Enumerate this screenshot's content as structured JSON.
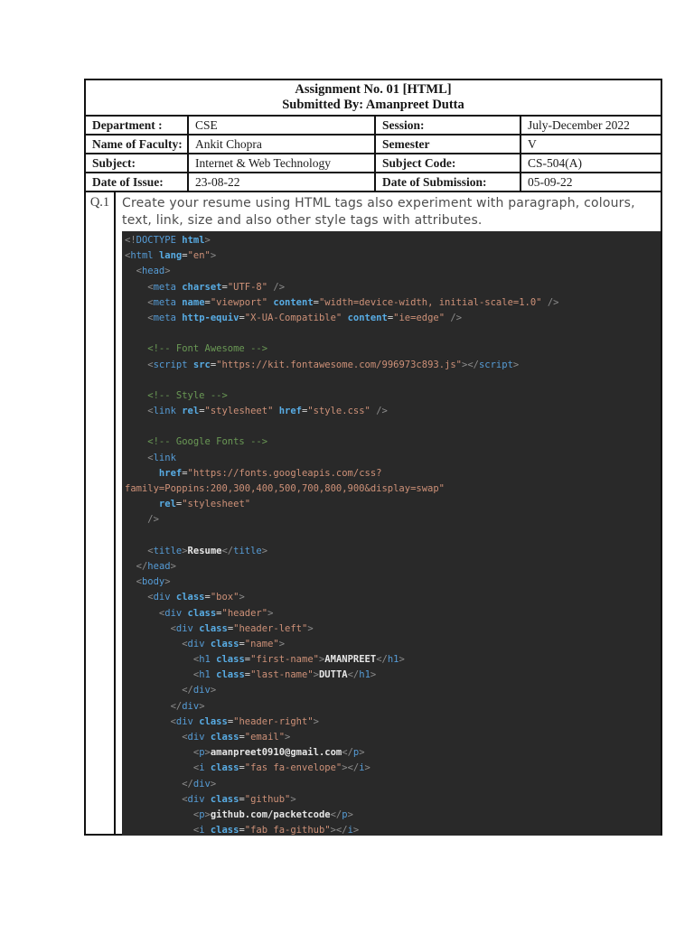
{
  "assignment_header": {
    "title_line1": "Assignment No. 01 [HTML]",
    "title_line2": "Submitted By: Amanpreet Dutta",
    "rows": [
      {
        "label1": "Department :",
        "value1": "CSE",
        "label2": "Session:",
        "value2": "July-December 2022"
      },
      {
        "label1": "Name of Faculty:",
        "value1": "Ankit Chopra",
        "label2": "Semester",
        "value2": "V"
      },
      {
        "label1": "Subject:",
        "value1": "Internet & Web Technology",
        "label2": "Subject Code:",
        "value2": "CS-504(A)"
      },
      {
        "label1": "Date of Issue:",
        "value1": "23-08-22",
        "label2": "Date of Submission:",
        "value2": "05-09-22"
      }
    ]
  },
  "question": {
    "number": "Q.1",
    "text": "Create your resume using HTML tags also experiment with paragraph, colours, text, link, size and also other style tags with attributes."
  },
  "code_editor": {
    "colors": {
      "code-bg": "#292929",
      "tk-p": "#8c8c8c",
      "tk-t": "#569cd6",
      "tk-a": "#58ace4",
      "tk-s": "#ce9178",
      "tk-e": "#d6d6d6",
      "tk-x": "#e6e6e6",
      "tk-c": "#6a9955"
    },
    "lines": [
      [
        {
          "c": "p",
          "t": "<!"
        },
        {
          "c": "t",
          "t": "DOCTYPE"
        },
        {
          "c": "a",
          "t": " html"
        },
        {
          "c": "p",
          "t": ">"
        }
      ],
      [
        {
          "c": "p",
          "t": "<"
        },
        {
          "c": "t",
          "t": "html"
        },
        {
          "c": "a",
          "t": " lang"
        },
        {
          "c": "e",
          "t": "="
        },
        {
          "c": "s",
          "t": "\"en\""
        },
        {
          "c": "p",
          "t": ">"
        }
      ],
      [
        {
          "c": "p",
          "t": "  <"
        },
        {
          "c": "t",
          "t": "head"
        },
        {
          "c": "p",
          "t": ">"
        }
      ],
      [
        {
          "c": "p",
          "t": "    <"
        },
        {
          "c": "t",
          "t": "meta"
        },
        {
          "c": "a",
          "t": " charset"
        },
        {
          "c": "e",
          "t": "="
        },
        {
          "c": "s",
          "t": "\"UTF-8\""
        },
        {
          "c": "p",
          "t": " />"
        }
      ],
      [
        {
          "c": "p",
          "t": "    <"
        },
        {
          "c": "t",
          "t": "meta"
        },
        {
          "c": "a",
          "t": " name"
        },
        {
          "c": "e",
          "t": "="
        },
        {
          "c": "s",
          "t": "\"viewport\""
        },
        {
          "c": "a",
          "t": " content"
        },
        {
          "c": "e",
          "t": "="
        },
        {
          "c": "s",
          "t": "\"width=device-width, initial-scale=1.0\""
        },
        {
          "c": "p",
          "t": " />"
        }
      ],
      [
        {
          "c": "p",
          "t": "    <"
        },
        {
          "c": "t",
          "t": "meta"
        },
        {
          "c": "a",
          "t": " http-equiv"
        },
        {
          "c": "e",
          "t": "="
        },
        {
          "c": "s",
          "t": "\"X-UA-Compatible\""
        },
        {
          "c": "a",
          "t": " content"
        },
        {
          "c": "e",
          "t": "="
        },
        {
          "c": "s",
          "t": "\"ie=edge\""
        },
        {
          "c": "p",
          "t": " />"
        }
      ],
      [],
      [
        {
          "c": "c",
          "t": "    <!-- Font Awesome -->"
        }
      ],
      [
        {
          "c": "p",
          "t": "    <"
        },
        {
          "c": "t",
          "t": "script"
        },
        {
          "c": "a",
          "t": " src"
        },
        {
          "c": "e",
          "t": "="
        },
        {
          "c": "s",
          "t": "\"https://kit.fontawesome.com/996973c893.js\""
        },
        {
          "c": "p",
          "t": "></"
        },
        {
          "c": "t",
          "t": "script"
        },
        {
          "c": "p",
          "t": ">"
        }
      ],
      [],
      [
        {
          "c": "c",
          "t": "    <!-- Style -->"
        }
      ],
      [
        {
          "c": "p",
          "t": "    <"
        },
        {
          "c": "t",
          "t": "link"
        },
        {
          "c": "a",
          "t": " rel"
        },
        {
          "c": "e",
          "t": "="
        },
        {
          "c": "s",
          "t": "\"stylesheet\""
        },
        {
          "c": "a",
          "t": " href"
        },
        {
          "c": "e",
          "t": "="
        },
        {
          "c": "s",
          "t": "\"style.css\""
        },
        {
          "c": "p",
          "t": " />"
        }
      ],
      [],
      [
        {
          "c": "c",
          "t": "    <!-- Google Fonts -->"
        }
      ],
      [
        {
          "c": "p",
          "t": "    <"
        },
        {
          "c": "t",
          "t": "link"
        }
      ],
      [
        {
          "c": "a",
          "t": "      href"
        },
        {
          "c": "e",
          "t": "="
        },
        {
          "c": "s",
          "t": "\"https://fonts.googleapis.com/css?"
        }
      ],
      [
        {
          "c": "s",
          "t": "family=Poppins:200,300,400,500,700,800,900&display=swap\""
        }
      ],
      [
        {
          "c": "a",
          "t": "      rel"
        },
        {
          "c": "e",
          "t": "="
        },
        {
          "c": "s",
          "t": "\"stylesheet\""
        }
      ],
      [
        {
          "c": "p",
          "t": "    />"
        }
      ],
      [],
      [
        {
          "c": "p",
          "t": "    <"
        },
        {
          "c": "t",
          "t": "title"
        },
        {
          "c": "p",
          "t": ">"
        },
        {
          "c": "x",
          "t": "Resume"
        },
        {
          "c": "p",
          "t": "</"
        },
        {
          "c": "t",
          "t": "title"
        },
        {
          "c": "p",
          "t": ">"
        }
      ],
      [
        {
          "c": "p",
          "t": "  </"
        },
        {
          "c": "t",
          "t": "head"
        },
        {
          "c": "p",
          "t": ">"
        }
      ],
      [
        {
          "c": "p",
          "t": "  <"
        },
        {
          "c": "t",
          "t": "body"
        },
        {
          "c": "p",
          "t": ">"
        }
      ],
      [
        {
          "c": "p",
          "t": "    <"
        },
        {
          "c": "t",
          "t": "div"
        },
        {
          "c": "a",
          "t": " class"
        },
        {
          "c": "e",
          "t": "="
        },
        {
          "c": "s",
          "t": "\"box\""
        },
        {
          "c": "p",
          "t": ">"
        }
      ],
      [
        {
          "c": "p",
          "t": "      <"
        },
        {
          "c": "t",
          "t": "div"
        },
        {
          "c": "a",
          "t": " class"
        },
        {
          "c": "e",
          "t": "="
        },
        {
          "c": "s",
          "t": "\"header\""
        },
        {
          "c": "p",
          "t": ">"
        }
      ],
      [
        {
          "c": "p",
          "t": "        <"
        },
        {
          "c": "t",
          "t": "div"
        },
        {
          "c": "a",
          "t": " class"
        },
        {
          "c": "e",
          "t": "="
        },
        {
          "c": "s",
          "t": "\"header-left\""
        },
        {
          "c": "p",
          "t": ">"
        }
      ],
      [
        {
          "c": "p",
          "t": "          <"
        },
        {
          "c": "t",
          "t": "div"
        },
        {
          "c": "a",
          "t": " class"
        },
        {
          "c": "e",
          "t": "="
        },
        {
          "c": "s",
          "t": "\"name\""
        },
        {
          "c": "p",
          "t": ">"
        }
      ],
      [
        {
          "c": "p",
          "t": "            <"
        },
        {
          "c": "t",
          "t": "h1"
        },
        {
          "c": "a",
          "t": " class"
        },
        {
          "c": "e",
          "t": "="
        },
        {
          "c": "s",
          "t": "\"first-name\""
        },
        {
          "c": "p",
          "t": ">"
        },
        {
          "c": "x",
          "t": "AMANPREET"
        },
        {
          "c": "p",
          "t": "</"
        },
        {
          "c": "t",
          "t": "h1"
        },
        {
          "c": "p",
          "t": ">"
        }
      ],
      [
        {
          "c": "p",
          "t": "            <"
        },
        {
          "c": "t",
          "t": "h1"
        },
        {
          "c": "a",
          "t": " class"
        },
        {
          "c": "e",
          "t": "="
        },
        {
          "c": "s",
          "t": "\"last-name\""
        },
        {
          "c": "p",
          "t": ">"
        },
        {
          "c": "x",
          "t": "DUTTA"
        },
        {
          "c": "p",
          "t": "</"
        },
        {
          "c": "t",
          "t": "h1"
        },
        {
          "c": "p",
          "t": ">"
        }
      ],
      [
        {
          "c": "p",
          "t": "          </"
        },
        {
          "c": "t",
          "t": "div"
        },
        {
          "c": "p",
          "t": ">"
        }
      ],
      [
        {
          "c": "p",
          "t": "        </"
        },
        {
          "c": "t",
          "t": "div"
        },
        {
          "c": "p",
          "t": ">"
        }
      ],
      [
        {
          "c": "p",
          "t": "        <"
        },
        {
          "c": "t",
          "t": "div"
        },
        {
          "c": "a",
          "t": " class"
        },
        {
          "c": "e",
          "t": "="
        },
        {
          "c": "s",
          "t": "\"header-right\""
        },
        {
          "c": "p",
          "t": ">"
        }
      ],
      [
        {
          "c": "p",
          "t": "          <"
        },
        {
          "c": "t",
          "t": "div"
        },
        {
          "c": "a",
          "t": " class"
        },
        {
          "c": "e",
          "t": "="
        },
        {
          "c": "s",
          "t": "\"email\""
        },
        {
          "c": "p",
          "t": ">"
        }
      ],
      [
        {
          "c": "p",
          "t": "            <"
        },
        {
          "c": "t",
          "t": "p"
        },
        {
          "c": "p",
          "t": ">"
        },
        {
          "c": "x",
          "t": "amanpreet0910@gmail.com"
        },
        {
          "c": "p",
          "t": "</"
        },
        {
          "c": "t",
          "t": "p"
        },
        {
          "c": "p",
          "t": ">"
        }
      ],
      [
        {
          "c": "p",
          "t": "            <"
        },
        {
          "c": "t",
          "t": "i"
        },
        {
          "c": "a",
          "t": " class"
        },
        {
          "c": "e",
          "t": "="
        },
        {
          "c": "s",
          "t": "\"fas fa-envelope\""
        },
        {
          "c": "p",
          "t": "></"
        },
        {
          "c": "t",
          "t": "i"
        },
        {
          "c": "p",
          "t": ">"
        }
      ],
      [
        {
          "c": "p",
          "t": "          </"
        },
        {
          "c": "t",
          "t": "div"
        },
        {
          "c": "p",
          "t": ">"
        }
      ],
      [
        {
          "c": "p",
          "t": "          <"
        },
        {
          "c": "t",
          "t": "div"
        },
        {
          "c": "a",
          "t": " class"
        },
        {
          "c": "e",
          "t": "="
        },
        {
          "c": "s",
          "t": "\"github\""
        },
        {
          "c": "p",
          "t": ">"
        }
      ],
      [
        {
          "c": "p",
          "t": "            <"
        },
        {
          "c": "t",
          "t": "p"
        },
        {
          "c": "p",
          "t": ">"
        },
        {
          "c": "x",
          "t": "github.com/packetcode"
        },
        {
          "c": "p",
          "t": "</"
        },
        {
          "c": "t",
          "t": "p"
        },
        {
          "c": "p",
          "t": ">"
        }
      ],
      [
        {
          "c": "p",
          "t": "            <"
        },
        {
          "c": "t",
          "t": "i"
        },
        {
          "c": "a",
          "t": " class"
        },
        {
          "c": "e",
          "t": "="
        },
        {
          "c": "s",
          "t": "\"fab fa-github\""
        },
        {
          "c": "p",
          "t": "></"
        },
        {
          "c": "t",
          "t": "i"
        },
        {
          "c": "p",
          "t": ">"
        }
      ]
    ]
  }
}
